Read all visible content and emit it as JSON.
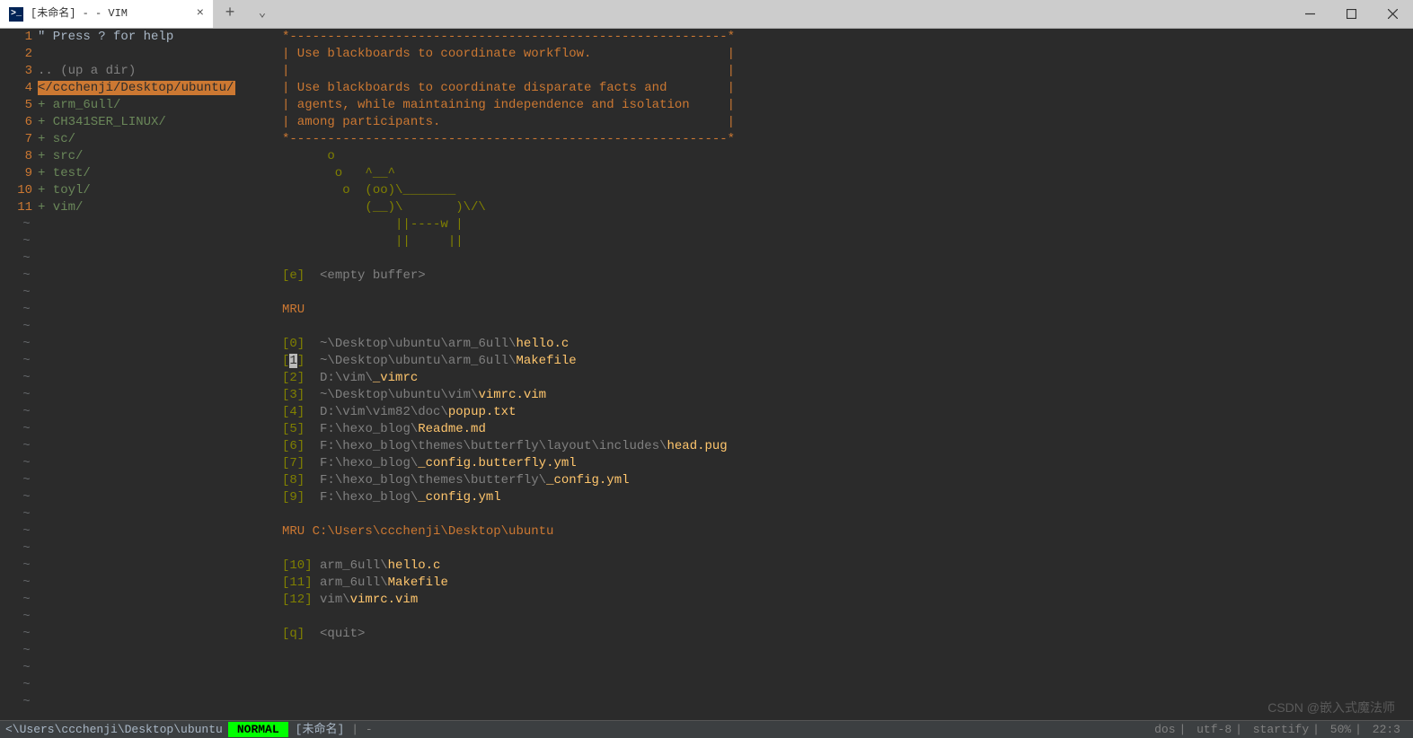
{
  "titlebar": {
    "tab_title": "[未命名] - - VIM",
    "close": "×",
    "newtab": "+",
    "dropdown": "⌄"
  },
  "gutter": {
    "numbers": [
      "1",
      "2",
      "3",
      "4",
      "5",
      "6",
      "7",
      "8",
      "9",
      "10",
      "11"
    ]
  },
  "sidebar": {
    "help": "\" Press ? for help",
    "blank": "",
    "updir": ".. (up a dir)",
    "current": "</ccchenji/Desktop/ubuntu/",
    "folders": [
      "+ arm_6ull/",
      "+ CH341SER_LINUX/",
      "+ sc/",
      "+ src/",
      "+ test/",
      "+ toyl/",
      "+ vim/"
    ]
  },
  "box": {
    "top": "*----------------------------------------------------------*",
    "l1": "| Use blackboards to coordinate workflow.                  |",
    "gap": "|                                                          |",
    "l2": "| Use blackboards to coordinate disparate facts and        |",
    "l3": "| agents, while maintaining independence and isolation     |",
    "l4": "| among participants.                                      |",
    "bot": "*----------------------------------------------------------*"
  },
  "cow": [
    "      o",
    "       o   ^__^",
    "        o  (oo)\\_______",
    "           (__)\\       )\\/\\",
    "               ||----w |",
    "               ||     ||"
  ],
  "empty": {
    "key": "[e]",
    "label": "<empty buffer>"
  },
  "mru_header": "MRU",
  "mru": [
    {
      "k": "[0]",
      "path": "~\\Desktop\\ubuntu\\arm_6ull\\",
      "file": "hello.c"
    },
    {
      "k": "[1]",
      "path": "~\\Desktop\\ubuntu\\arm_6ull\\",
      "file": "Makefile"
    },
    {
      "k": "[2]",
      "path": "D:\\vim\\",
      "file": "_vimrc"
    },
    {
      "k": "[3]",
      "path": "~\\Desktop\\ubuntu\\vim\\",
      "file": "vimrc.vim"
    },
    {
      "k": "[4]",
      "path": "D:\\vim\\vim82\\doc\\",
      "file": "popup.txt"
    },
    {
      "k": "[5]",
      "path": "F:\\hexo_blog\\",
      "file": "Readme.md"
    },
    {
      "k": "[6]",
      "path": "F:\\hexo_blog\\themes\\butterfly\\layout\\includes\\",
      "file": "head.pug"
    },
    {
      "k": "[7]",
      "path": "F:\\hexo_blog\\",
      "file": "_config.butterfly.yml"
    },
    {
      "k": "[8]",
      "path": "F:\\hexo_blog\\themes\\butterfly\\",
      "file": "_config.yml"
    },
    {
      "k": "[9]",
      "path": "F:\\hexo_blog\\",
      "file": "_config.yml"
    }
  ],
  "mru2_header": "MRU C:\\Users\\ccchenji\\Desktop\\ubuntu",
  "mru2": [
    {
      "k": "[10]",
      "path": "arm_6ull\\",
      "file": "hello.c"
    },
    {
      "k": "[11]",
      "path": "arm_6ull\\",
      "file": "Makefile"
    },
    {
      "k": "[12]",
      "path": "vim\\",
      "file": "vimrc.vim"
    }
  ],
  "quit": {
    "key": "[q]",
    "label": "<quit>"
  },
  "status": {
    "path": "<\\Users\\ccchenji\\Desktop\\ubuntu",
    "mode": "NORMAL",
    "filename": "[未命名]",
    "pipe": "| -",
    "enc": "dos",
    "charset": "utf-8",
    "ft": "startify",
    "pct": "50%",
    "pos": "22:3"
  },
  "watermark": "CSDN @嵌入式魔法师"
}
